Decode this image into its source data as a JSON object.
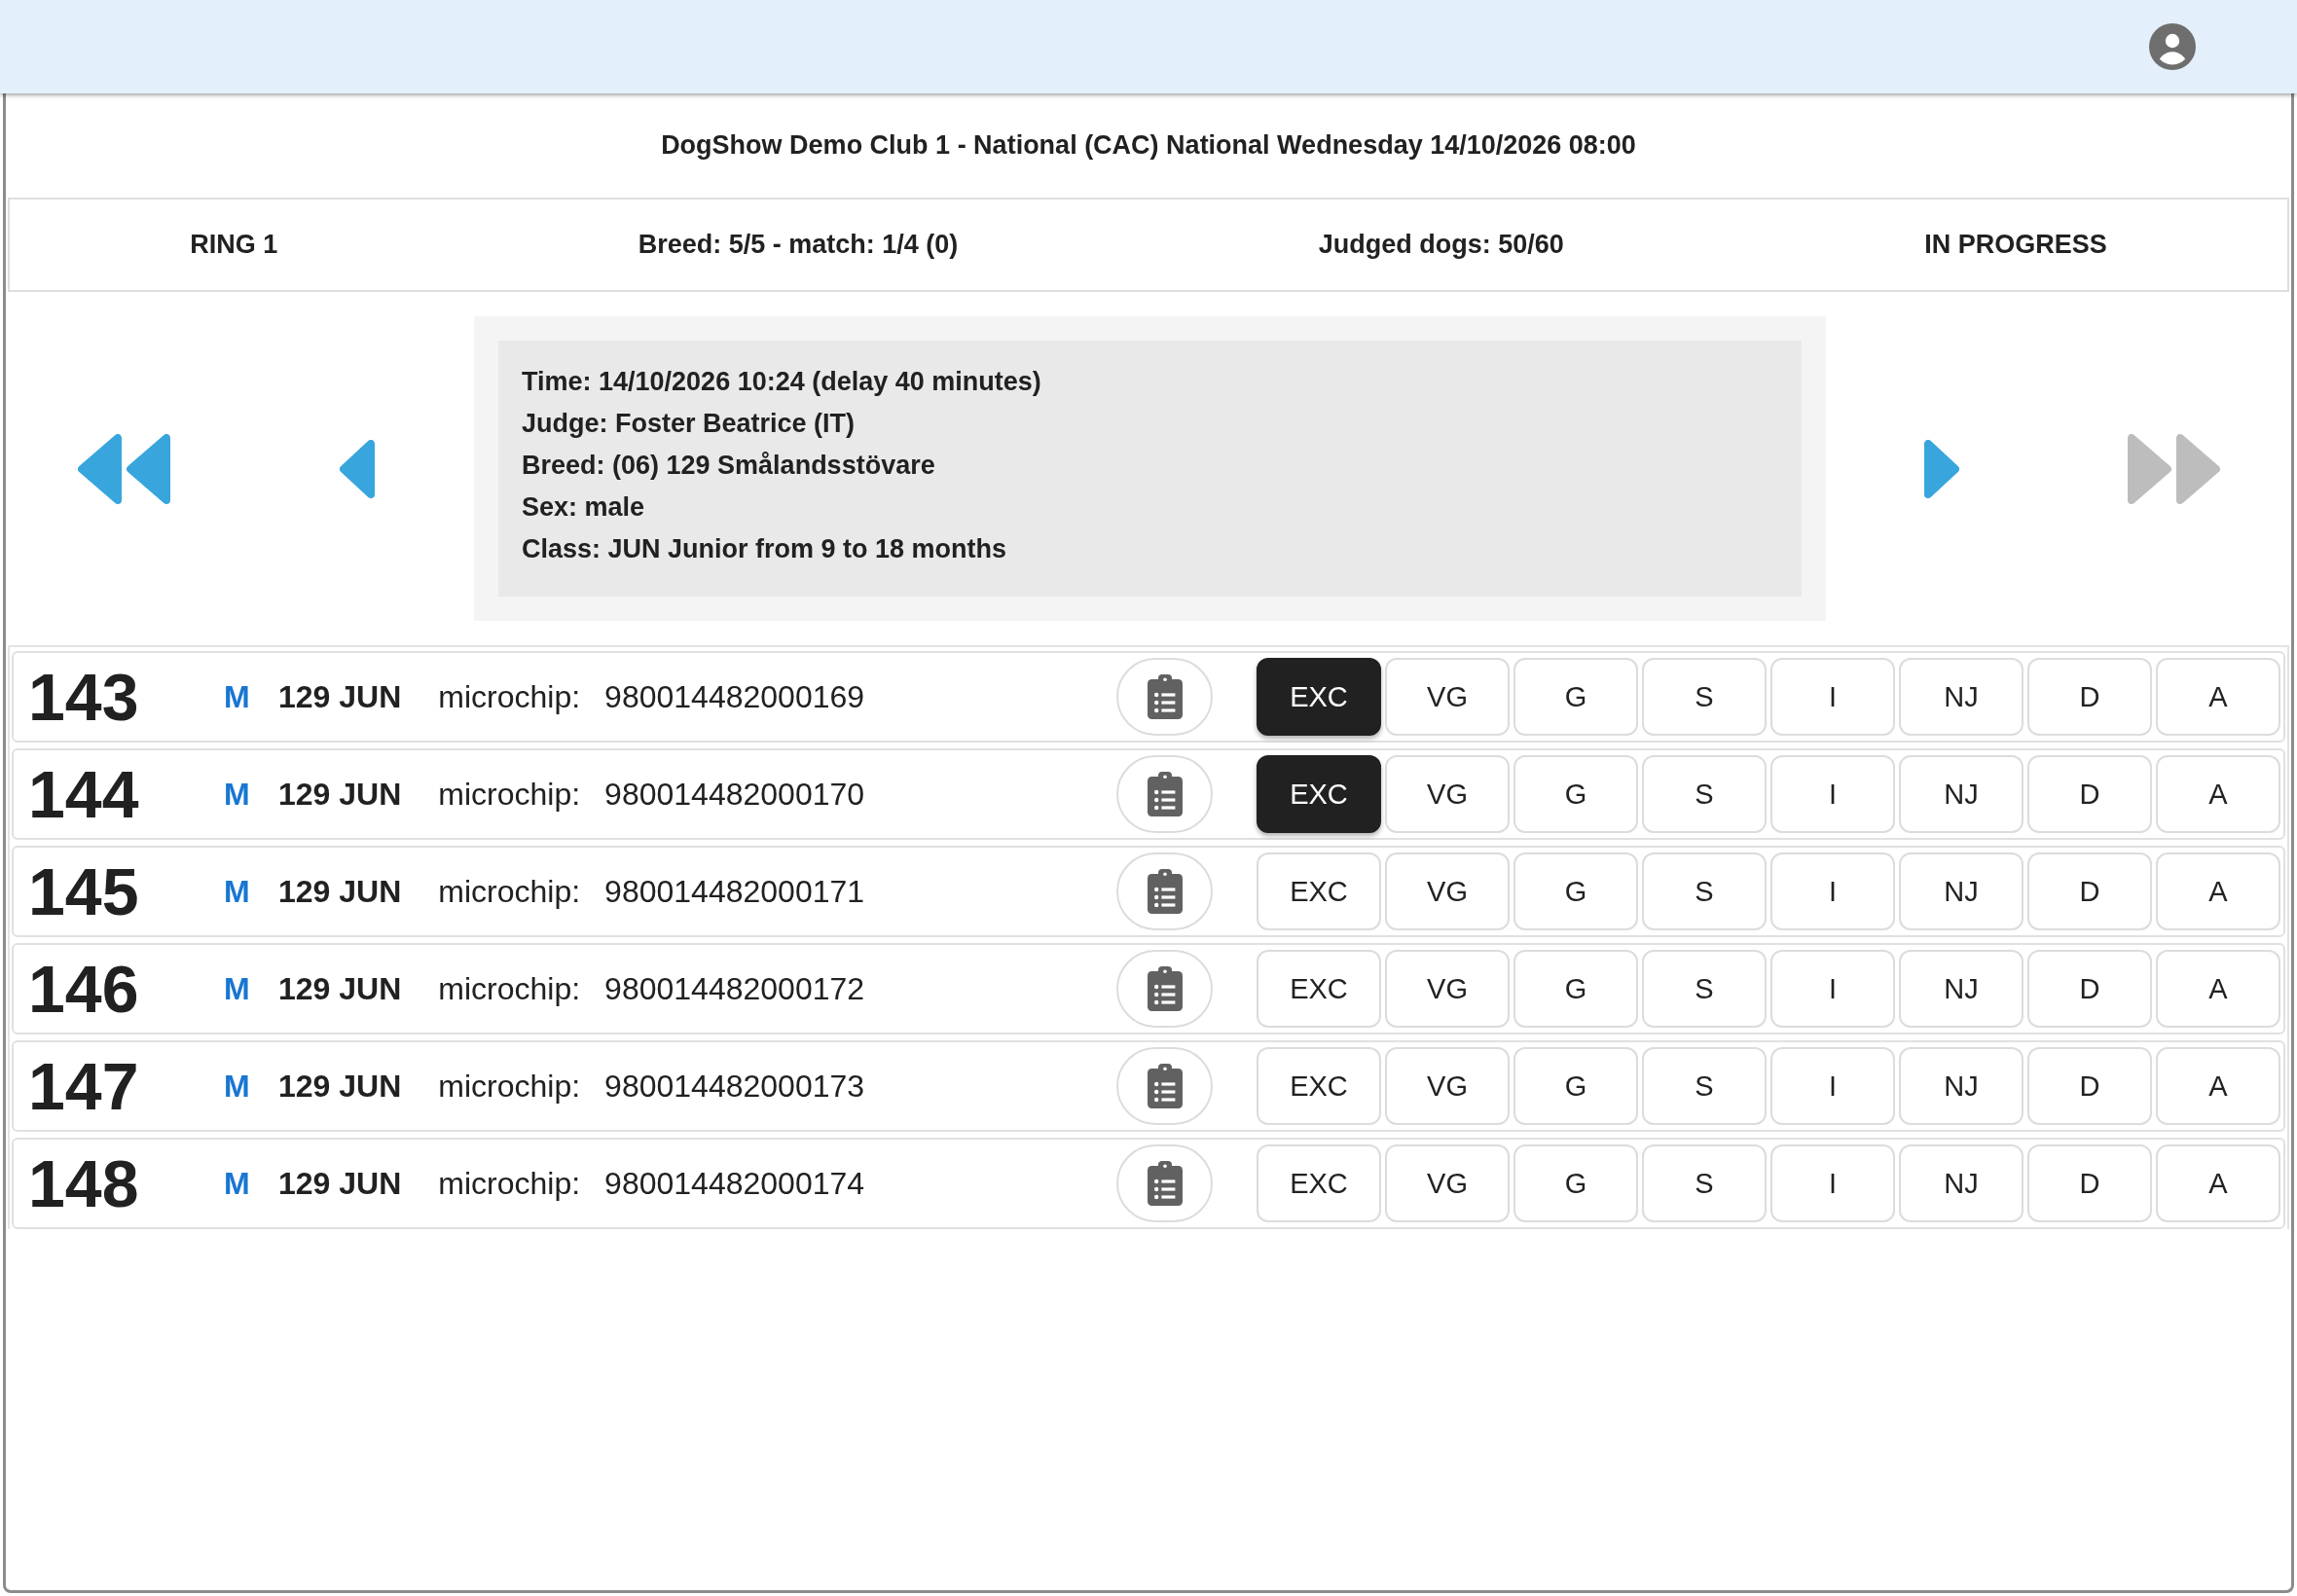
{
  "show_title": "DogShow Demo Club 1 - National (CAC) National Wednesday 14/10/2026 08:00",
  "status_bar": [
    "RING 1",
    "Breed: 5/5 - match: 1/4 (0)",
    "Judged dogs: 50/60",
    "IN PROGRESS"
  ],
  "navigation": {
    "back": [
      {
        "kind": "first",
        "disabled": false
      },
      {
        "kind": "previous",
        "disabled": false
      }
    ],
    "forward": [
      {
        "kind": "next",
        "disabled": false
      },
      {
        "kind": "last",
        "disabled": true
      }
    ]
  },
  "class_info": [
    "Time: 14/10/2026 10:24 (delay 40 minutes)",
    "Judge: Foster Beatrice (IT)",
    "Breed: (06) 129 Smålandsstövare",
    "Sex: male",
    "Class: JUN Junior from 9 to 18 months"
  ],
  "entries": [
    {
      "number": "143",
      "sex": "M",
      "breed_class": "129 JUN",
      "microchip_label": "microchip:",
      "microchip": "980014482000169",
      "grades": [
        {
          "label": "EXC",
          "selected": true
        },
        {
          "label": "VG",
          "selected": false
        },
        {
          "label": "G",
          "selected": false
        },
        {
          "label": "S",
          "selected": false
        },
        {
          "label": "I",
          "selected": false
        },
        {
          "label": "NJ",
          "selected": false
        },
        {
          "label": "D",
          "selected": false
        },
        {
          "label": "A",
          "selected": false
        }
      ]
    },
    {
      "number": "144",
      "sex": "M",
      "breed_class": "129 JUN",
      "microchip_label": "microchip:",
      "microchip": "980014482000170",
      "grades": [
        {
          "label": "EXC",
          "selected": true
        },
        {
          "label": "VG",
          "selected": false
        },
        {
          "label": "G",
          "selected": false
        },
        {
          "label": "S",
          "selected": false
        },
        {
          "label": "I",
          "selected": false
        },
        {
          "label": "NJ",
          "selected": false
        },
        {
          "label": "D",
          "selected": false
        },
        {
          "label": "A",
          "selected": false
        }
      ]
    },
    {
      "number": "145",
      "sex": "M",
      "breed_class": "129 JUN",
      "microchip_label": "microchip:",
      "microchip": "980014482000171",
      "grades": [
        {
          "label": "EXC",
          "selected": false
        },
        {
          "label": "VG",
          "selected": false
        },
        {
          "label": "G",
          "selected": false
        },
        {
          "label": "S",
          "selected": false
        },
        {
          "label": "I",
          "selected": false
        },
        {
          "label": "NJ",
          "selected": false
        },
        {
          "label": "D",
          "selected": false
        },
        {
          "label": "A",
          "selected": false
        }
      ]
    },
    {
      "number": "146",
      "sex": "M",
      "breed_class": "129 JUN",
      "microchip_label": "microchip:",
      "microchip": "980014482000172",
      "grades": [
        {
          "label": "EXC",
          "selected": false
        },
        {
          "label": "VG",
          "selected": false
        },
        {
          "label": "G",
          "selected": false
        },
        {
          "label": "S",
          "selected": false
        },
        {
          "label": "I",
          "selected": false
        },
        {
          "label": "NJ",
          "selected": false
        },
        {
          "label": "D",
          "selected": false
        },
        {
          "label": "A",
          "selected": false
        }
      ]
    },
    {
      "number": "147",
      "sex": "M",
      "breed_class": "129 JUN",
      "microchip_label": "microchip:",
      "microchip": "980014482000173",
      "grades": [
        {
          "label": "EXC",
          "selected": false
        },
        {
          "label": "VG",
          "selected": false
        },
        {
          "label": "G",
          "selected": false
        },
        {
          "label": "S",
          "selected": false
        },
        {
          "label": "I",
          "selected": false
        },
        {
          "label": "NJ",
          "selected": false
        },
        {
          "label": "D",
          "selected": false
        },
        {
          "label": "A",
          "selected": false
        }
      ]
    },
    {
      "number": "148",
      "sex": "M",
      "breed_class": "129 JUN",
      "microchip_label": "microchip:",
      "microchip": "980014482000174",
      "grades": [
        {
          "label": "EXC",
          "selected": false
        },
        {
          "label": "VG",
          "selected": false
        },
        {
          "label": "G",
          "selected": false
        },
        {
          "label": "S",
          "selected": false
        },
        {
          "label": "I",
          "selected": false
        },
        {
          "label": "NJ",
          "selected": false
        },
        {
          "label": "D",
          "selected": false
        },
        {
          "label": "A",
          "selected": false
        }
      ]
    }
  ]
}
